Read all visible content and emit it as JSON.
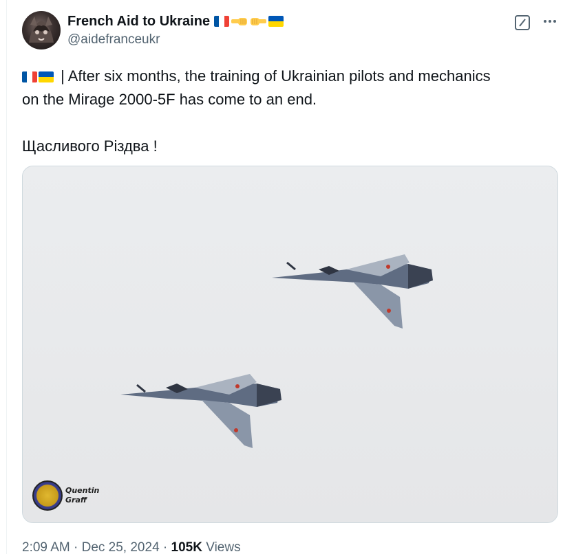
{
  "author": {
    "display_name": "French Aid to Ukraine",
    "handle": "@aidefranceukr",
    "name_emoji": [
      "flag-france",
      "fist-bump-left",
      "fist-bump-right",
      "flag-ukraine"
    ]
  },
  "post": {
    "line1": " | After six months, the training of Ukrainian pilots and mechanics",
    "line2": "on the Mirage 2000-5F has come to an end.",
    "line3": "Щасливого Різдва !",
    "leading_emoji": [
      "flag-france",
      "flag-ukraine"
    ]
  },
  "media": {
    "description_icons": [
      "jet-icon",
      "jet-icon"
    ],
    "watermark_line1": "Quentin",
    "watermark_line2": "Graff"
  },
  "meta": {
    "time": "2:09 AM",
    "separator": "·",
    "date": "Dec 25, 2024",
    "views_count": "105K",
    "views_label": "Views"
  },
  "colors": {
    "text": "#0f1419",
    "secondary": "#536471",
    "border": "#cfd9de",
    "france_blue": "#0055A4",
    "france_red": "#EF4135",
    "ukraine_blue": "#0057B7",
    "ukraine_yellow": "#FFD700"
  }
}
